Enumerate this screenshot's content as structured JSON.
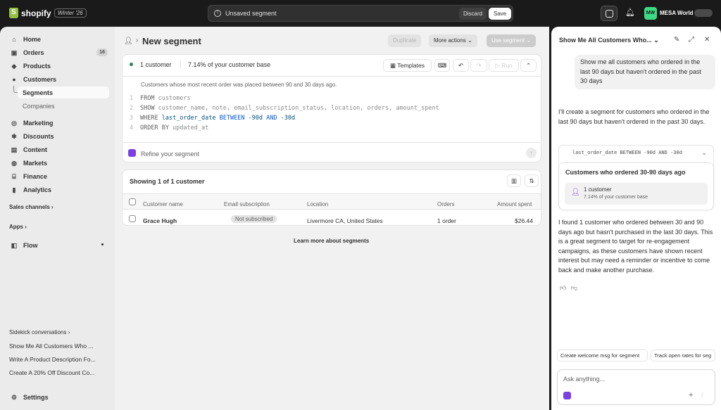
{
  "topbar": {
    "brand": "shopify",
    "edition": "Winter '26",
    "unsaved_text": "Unsaved segment",
    "discard_label": "Discard",
    "save_label": "Save",
    "avatar_initials": "MW",
    "store_name": "MESA World"
  },
  "sidebar": {
    "items": [
      {
        "label": "Home",
        "icon": "home-icon"
      },
      {
        "label": "Orders",
        "icon": "orders-icon",
        "count": "16"
      },
      {
        "label": "Products",
        "icon": "tag-icon"
      },
      {
        "label": "Customers",
        "icon": "person-icon"
      },
      {
        "label": "Segments",
        "active": true
      },
      {
        "label": "Companies"
      },
      {
        "label": "Marketing",
        "icon": "target-icon"
      },
      {
        "label": "Discounts",
        "icon": "discount-icon"
      },
      {
        "label": "Content",
        "icon": "content-icon"
      },
      {
        "label": "Markets",
        "icon": "globe-icon"
      },
      {
        "label": "Finance",
        "icon": "bank-icon"
      },
      {
        "label": "Analytics",
        "icon": "chart-icon"
      }
    ],
    "sales_channels": "Sales channels",
    "apps": "Apps",
    "flow": "Flow",
    "sidekick_conversations": "Sidekick conversations",
    "conversations": [
      "Show Me All Customers Who ...",
      "Write A Product Description Fo...",
      "Create A 20% Off Discount Co..."
    ],
    "settings": "Settings"
  },
  "main": {
    "title": "New segment",
    "duplicate": "Duplicate",
    "more_actions": "More actions",
    "use_segment": "Use segment",
    "count": "1 customer",
    "percent": "7.14%",
    "percent_suffix": "of your customer base",
    "templates": "Templates",
    "run": "Run",
    "description": "Customers whose most recent order was placed between 90 and 30 days ago.",
    "code": [
      {
        "n": "1",
        "kw": "FROM",
        "rest": "customers"
      },
      {
        "n": "2",
        "kw": "SHOW",
        "rest": "customer_name, note, email_subscription_status, location, orders, amount_spent"
      },
      {
        "n": "3",
        "kw": "WHERE",
        "field": "last_order_date",
        "op": "BETWEEN",
        "v1": "-90d",
        "and": "AND",
        "v2": "-30d"
      },
      {
        "n": "4",
        "kw": "ORDER BY",
        "rest": "updated_at"
      }
    ],
    "refine_placeholder": "Refine your segment",
    "table": {
      "showing": "Showing 1 of 1 customer",
      "headers": [
        "Customer name",
        "Email subscription",
        "Location",
        "Orders",
        "Amount spent"
      ],
      "rows": [
        {
          "name": "Grace Hugh",
          "email": "Not subscribed",
          "location": "Livermore CA, United States",
          "orders": "1 order",
          "amount": "$26.44"
        }
      ]
    },
    "learn_more": "Learn more about segments"
  },
  "sidekick": {
    "title": "Show Me All Customers Who...",
    "user_message": "Show me all customers who ordered in the last 90 days but haven't ordered in the past 30 days",
    "ai_message_1": "I'll create a segment for customers who ordered in the last 90 days but haven't ordered in the past 30 days.",
    "sql_preview": "last_order_date BETWEEN -90d AND -30d",
    "segment_title": "Customers who ordered 30-90 days ago",
    "segment_count": "1 customer",
    "segment_percent": "7.14% of your customer base",
    "ai_message_2": "I found 1 customer who ordered between 30 and 90 days ago but hasn't purchased in the last 30 days. This is a great segment to target for re-engagement campaigns, as these customers have shown recent interest but may need a reminder or incentive to come back and make another purchase.",
    "chips": [
      "Create welcome msg for segment",
      "Track open rates for seg"
    ],
    "ask_placeholder": "Ask anything..."
  },
  "colors": {
    "accent_green": "#29845a",
    "sidekick_purple": "#7b3fe4",
    "avatar_green": "#3ddc84",
    "topbar": "#1a1a1a"
  }
}
